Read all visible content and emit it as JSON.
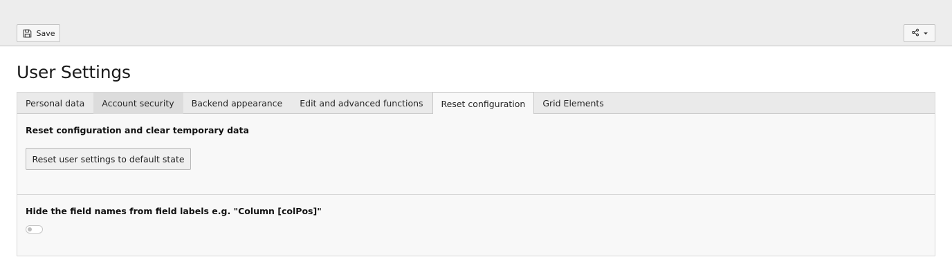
{
  "toolbar": {
    "save_label": "Save",
    "save_icon": "floppy-disk-icon",
    "share_icon": "share-icon"
  },
  "page": {
    "title": "User Settings"
  },
  "tabs": [
    {
      "label": "Personal data",
      "state": "normal"
    },
    {
      "label": "Account security",
      "state": "hover"
    },
    {
      "label": "Backend appearance",
      "state": "normal"
    },
    {
      "label": "Edit and advanced functions",
      "state": "normal"
    },
    {
      "label": "Reset configuration",
      "state": "active"
    },
    {
      "label": "Grid Elements",
      "state": "normal"
    }
  ],
  "reset_section": {
    "heading": "Reset configuration and clear temporary data",
    "button_label": "Reset user settings to default state"
  },
  "field_names_section": {
    "heading": "Hide the field names from field labels e.g. \"Column [colPos]\"",
    "toggle_checked": false
  }
}
